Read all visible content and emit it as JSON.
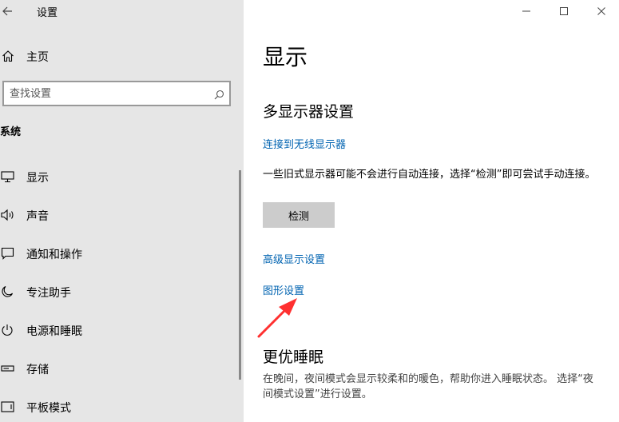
{
  "window": {
    "app_title": "设置",
    "controls": {
      "minimize_icon": "minimize-icon",
      "maximize_icon": "maximize-icon",
      "close_icon": "close-icon"
    }
  },
  "sidebar": {
    "back_icon": "back-arrow-icon",
    "home": {
      "label": "主页",
      "icon": "home-icon"
    },
    "search": {
      "placeholder": "查找设置",
      "icon": "search-icon"
    },
    "section_label": "系统",
    "items": [
      {
        "label": "显示",
        "icon": "monitor-icon"
      },
      {
        "label": "声音",
        "icon": "speaker-icon"
      },
      {
        "label": "通知和操作",
        "icon": "message-icon"
      },
      {
        "label": "专注助手",
        "icon": "moon-icon"
      },
      {
        "label": "电源和睡眠",
        "icon": "power-icon"
      },
      {
        "label": "存储",
        "icon": "storage-icon"
      },
      {
        "label": "平板模式",
        "icon": "tablet-icon"
      }
    ]
  },
  "main": {
    "title": "显示",
    "multi_display": {
      "heading": "多显示器设置",
      "wireless_link": "连接到无线显示器",
      "description": "一些旧式显示器可能不会进行自动连接，选择“检测”即可尝试手动连接。",
      "detect_button": "检测",
      "advanced_link": "高级显示设置",
      "graphics_link": "图形设置"
    },
    "sleep": {
      "heading": "更优睡眠",
      "description": "在晚间，夜间模式会显示较柔和的暖色，帮助你进入睡眠状态。 选择“夜间模式设置”进行设置。"
    }
  },
  "annotation": {
    "arrow_color": "#ff3030"
  },
  "colors": {
    "sidebar_bg": "#e6e6e6",
    "link": "#0063b1",
    "button_bg": "#cccccc"
  }
}
